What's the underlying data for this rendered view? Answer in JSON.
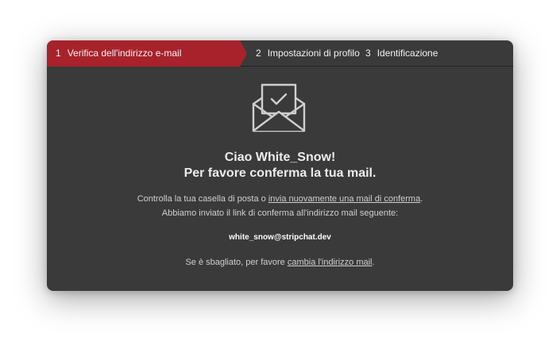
{
  "stepper": {
    "steps": [
      {
        "number": "1",
        "label": "Verifica dell'indirizzo e-mail"
      },
      {
        "number": "2",
        "label": "Impostazioni di profilo"
      },
      {
        "number": "3",
        "label": "Identificazione"
      }
    ]
  },
  "colors": {
    "active_step": "#a8222b",
    "panel_bg": "#3a3a3a"
  },
  "icon": "envelope-check-icon",
  "main": {
    "greeting": "Ciao White_Snow!",
    "subtitle": "Per favore conferma la tua mail.",
    "line1_prefix": "Controlla la tua casella di posta o ",
    "resend_link": "invia nuovamente una mail di conferma",
    "line1_suffix": ".",
    "line2": "Abbiamo inviato il link di conferma all'indirizzo mail seguente:",
    "email": "white_snow@stripchat.dev",
    "line3_prefix": "Se è sbagliato, per favore ",
    "change_link": "cambia l'indirizzo mail",
    "line3_suffix": "."
  }
}
